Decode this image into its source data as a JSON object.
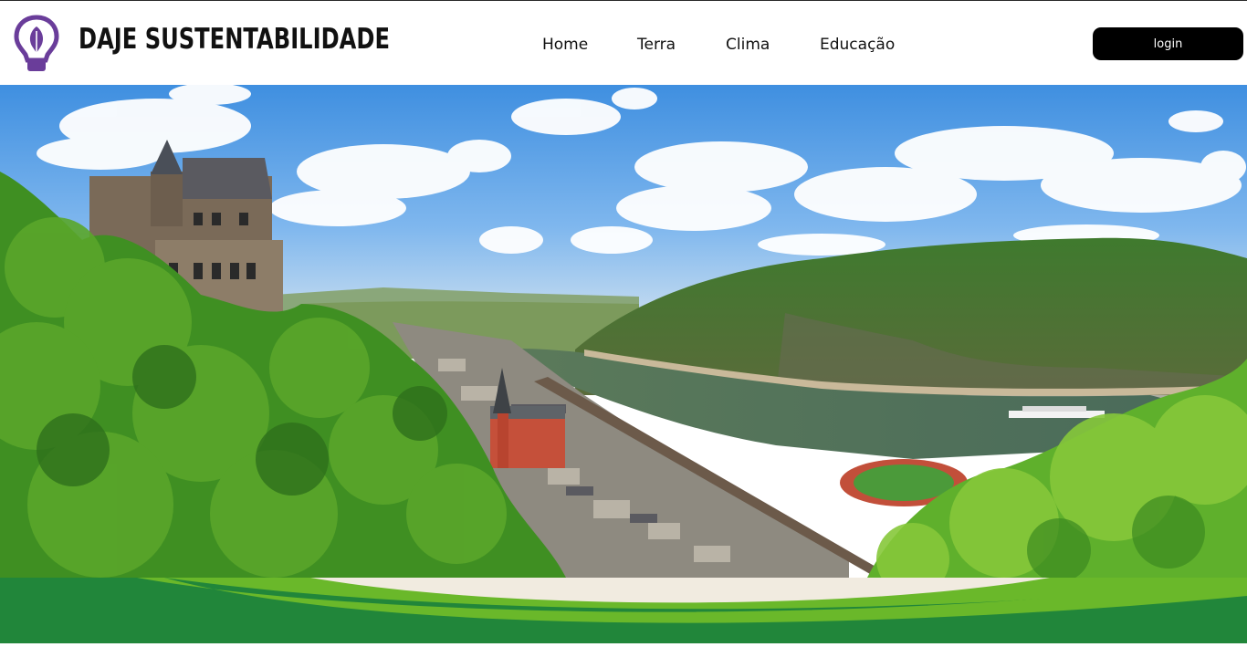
{
  "brand": {
    "name": "DAJE SUSTENTABILIDADE",
    "logo_icon": "lightbulb-leaf-icon"
  },
  "nav": {
    "items": [
      {
        "label": "Home"
      },
      {
        "label": "Terra"
      },
      {
        "label": "Clima"
      },
      {
        "label": "Educação"
      }
    ]
  },
  "login": {
    "label": "login"
  },
  "hero": {
    "image": "panorama-castle-river-valley"
  },
  "colors": {
    "accent_purple": "#6a3d9a",
    "band_dark_green": "#21863a",
    "band_light_green": "#6ab82a",
    "band_cream": "#f1ebe0",
    "button_black": "#000000"
  }
}
